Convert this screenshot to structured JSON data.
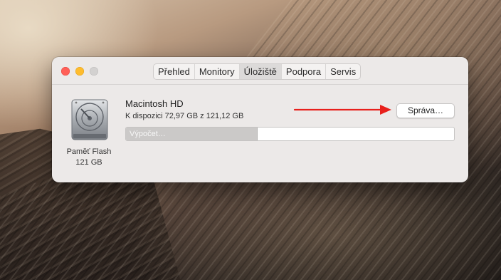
{
  "window": {
    "tabs": [
      {
        "label": "Přehled",
        "active": false
      },
      {
        "label": "Monitory",
        "active": false
      },
      {
        "label": "Úložiště",
        "active": true
      },
      {
        "label": "Podpora",
        "active": false
      },
      {
        "label": "Servis",
        "active": false
      }
    ]
  },
  "storage": {
    "disk_name": "Macintosh HD",
    "availability": "K dispozici 72,97 GB z 121,12 GB",
    "manage_button": "Správa…",
    "bar_label": "Výpočet…",
    "used_fraction": 0.4,
    "drive_caption_line1": "Paměť Flash",
    "drive_caption_line2": "121 GB"
  },
  "colors": {
    "close": "#ff5f57",
    "minimize": "#febc2e",
    "maximize_disabled": "#d3d1d0",
    "annotation_arrow": "#e8201c"
  },
  "icons": [
    "close-icon",
    "minimize-icon",
    "zoom-icon",
    "hard-drive-icon",
    "arrow-annotation-icon"
  ]
}
